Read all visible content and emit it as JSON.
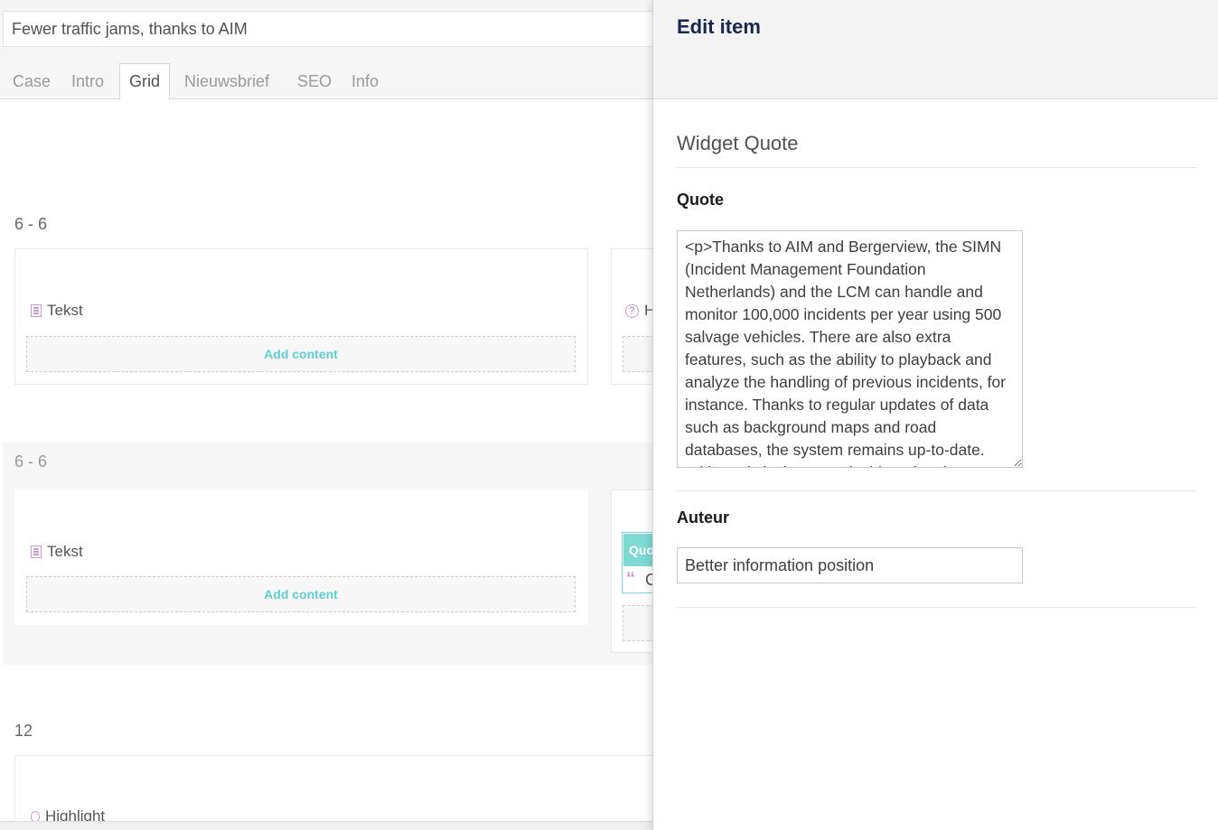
{
  "document": {
    "name": "Fewer traffic jams, thanks to AIM"
  },
  "tabs": [
    {
      "label": "Case"
    },
    {
      "label": "Intro"
    },
    {
      "label": "Grid",
      "active": true
    },
    {
      "label": "Nieuwsbrief"
    },
    {
      "label": "SEO"
    },
    {
      "label": "Info"
    }
  ],
  "grid": {
    "rows": [
      {
        "label": "6 - 6",
        "left_cell": "Tekst",
        "right_cell_partial": "H",
        "add_label": "Add content"
      },
      {
        "label": "6 - 6",
        "left_cell": "Tekst",
        "right_chip": "Quo",
        "right_snippet": "C",
        "add_label": "Add content"
      },
      {
        "label": "12",
        "cell": "Highlight"
      }
    ]
  },
  "panel": {
    "title": "Edit item",
    "section": "Widget Quote",
    "quote_label": "Quote",
    "quote_value": "<p>Thanks to AIM and Bergerview, the SIMN (Incident Management Foundation Netherlands) and the LCM can handle and monitor 100,000 incidents per year using 500 salvage vehicles. There are also extra features, such as the ability to playback and analyze the handling of previous incidents, for instance. Thanks to regular updates of data such as background maps and road databases, the system remains up-to-date. With analytical reports, incident data is",
    "author_label": "Auteur",
    "author_value": "Better information position"
  },
  "colors": {
    "accent_teal": "#5fcfcf",
    "icon_purple": "#c79ad0",
    "title_navy": "#1b264f"
  }
}
